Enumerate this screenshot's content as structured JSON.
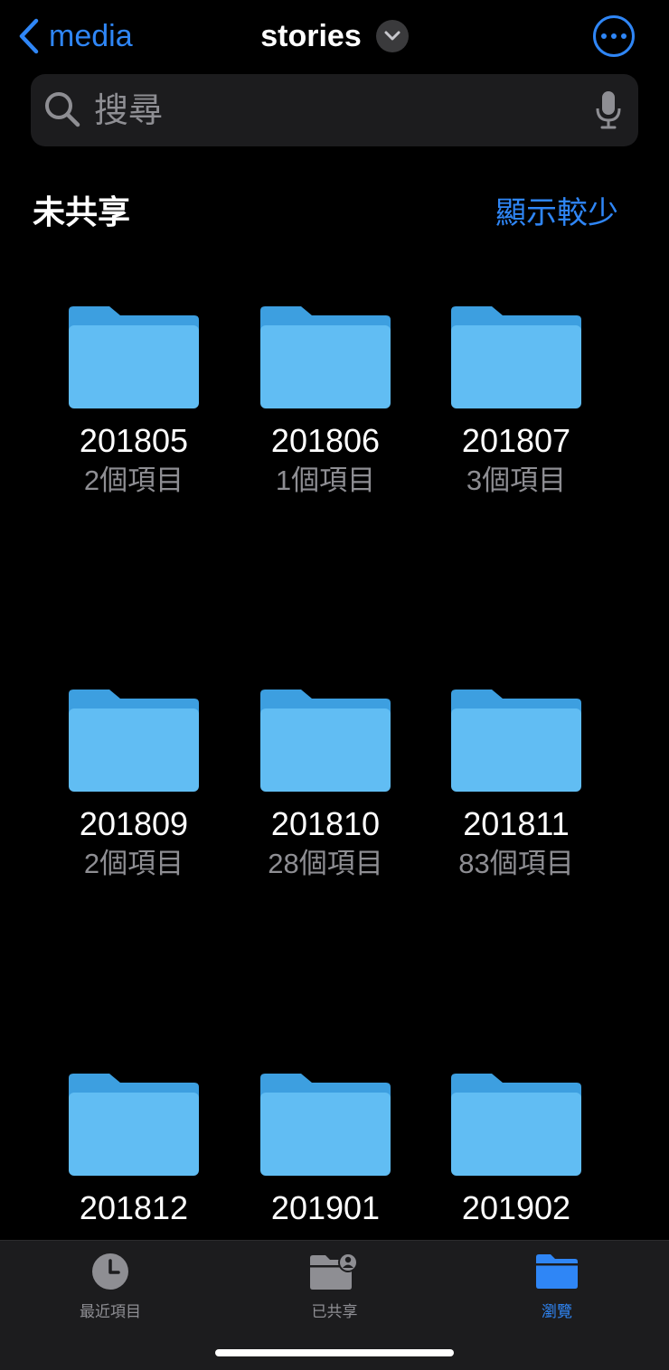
{
  "nav": {
    "back_label": "media",
    "title": "stories"
  },
  "search": {
    "placeholder": "搜尋"
  },
  "section": {
    "title": "未共享",
    "action_label": "顯示較少"
  },
  "folders": [
    {
      "name": "201805",
      "count": "2個項目"
    },
    {
      "name": "201806",
      "count": "1個項目"
    },
    {
      "name": "201807",
      "count": "3個項目"
    },
    {
      "name": "201809",
      "count": "2個項目"
    },
    {
      "name": "201810",
      "count": "28個項目"
    },
    {
      "name": "201811",
      "count": "83個項目"
    },
    {
      "name": "201812",
      "count": ""
    },
    {
      "name": "201901",
      "count": ""
    },
    {
      "name": "201902",
      "count": ""
    }
  ],
  "tabbar": {
    "tabs": [
      {
        "label": "最近項目",
        "icon": "clock-icon",
        "active": false
      },
      {
        "label": "已共享",
        "icon": "shared-folder-icon",
        "active": false
      },
      {
        "label": "瀏覽",
        "icon": "folder-icon",
        "active": true
      }
    ]
  },
  "colors": {
    "accent": "#2f86f6",
    "folder_light": "#61bdf3",
    "folder_dark": "#3d9fe0",
    "secondary_text": "#8e8e93"
  }
}
